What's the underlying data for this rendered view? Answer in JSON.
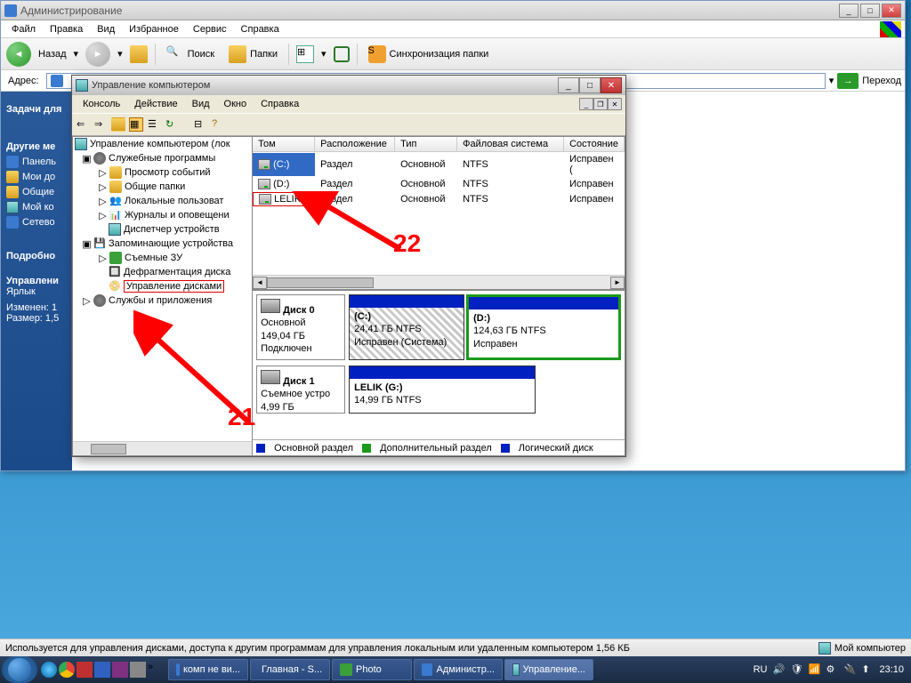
{
  "os": {
    "background_top_gradient": "#1a6ba8"
  },
  "explorer": {
    "title": "Администрирование",
    "menubar": [
      "Файл",
      "Правка",
      "Вид",
      "Избранное",
      "Сервис",
      "Справка"
    ],
    "toolbar": {
      "back": "Назад",
      "search": "Поиск",
      "folders": "Папки",
      "sync": "Синхронизация папки"
    },
    "addressbar": {
      "label": "Адрес:",
      "go": "Переход"
    },
    "tasks": {
      "title": "Задачи для",
      "places_title": "Другие ме",
      "places": [
        "Панель",
        "Мои до",
        "Общие",
        "Мой ко",
        "Сетево"
      ],
      "details_title": "Подробно",
      "details": {
        "name": "Управлени",
        "type": "Ярлык",
        "modified": "Изменен: 1",
        "size": "Размер: 1,5"
      }
    }
  },
  "mmc": {
    "title": "Управление компьютером",
    "menubar": [
      "Консоль",
      "Действие",
      "Вид",
      "Окно",
      "Справка"
    ],
    "tree": {
      "root": "Управление компьютером (лок",
      "system_tools": "Служебные программы",
      "items1": [
        "Просмотр событий",
        "Общие папки",
        "Локальные пользоват",
        "Журналы и оповещени",
        "Диспетчер устройств"
      ],
      "storage": "Запоминающие устройства",
      "items2": [
        "Съемные ЗУ",
        "Дефрагментация диска"
      ],
      "disk_mgmt": "Управление дисками",
      "services": "Службы и приложения"
    },
    "volumes": {
      "headers": [
        "Том",
        "Расположение",
        "Тип",
        "Файловая система",
        "Состояние"
      ],
      "rows": [
        {
          "vol": "(C:)",
          "layout": "Раздел",
          "type": "Основной",
          "fs": "NTFS",
          "state": "Исправен ("
        },
        {
          "vol": "(D:)",
          "layout": "Раздел",
          "type": "Основной",
          "fs": "NTFS",
          "state": "Исправен"
        },
        {
          "vol": "LELIK",
          "layout": "Раздел",
          "type": "Основной",
          "fs": "NTFS",
          "state": "Исправен"
        }
      ]
    },
    "disks": {
      "disk0": {
        "name": "Диск 0",
        "type": "Основной",
        "size": "149,04 ГБ",
        "status": "Подключен"
      },
      "disk0_c": {
        "label": "(C:)",
        "size": "24,41 ГБ NTFS",
        "state": "Исправен (Система)"
      },
      "disk0_d": {
        "label": "(D:)",
        "size": "124,63 ГБ NTFS",
        "state": "Исправен"
      },
      "disk1": {
        "name": "Диск 1",
        "type": "Съемное устро",
        "size": "4,99 ГБ"
      },
      "disk1_g": {
        "label": "LELIK  (G:)",
        "size": "14,99 ГБ NTFS"
      }
    },
    "legend": {
      "primary": "Основной раздел",
      "extended": "Дополнительный раздел",
      "logical": "Логический диск"
    }
  },
  "statusbar": {
    "text": "Используется для управления дисками, доступа к другим программам для управления локальным или удаленным компьютером 1,56 КБ",
    "mycomputer": "Мой компьютер"
  },
  "taskbar": {
    "items": [
      "комп не ви...",
      "Главная - S...",
      "Photo",
      "Администр...",
      "Управление..."
    ],
    "lang": "RU",
    "time": "23:10"
  },
  "annotations": {
    "n21": "21",
    "n22": "22"
  }
}
